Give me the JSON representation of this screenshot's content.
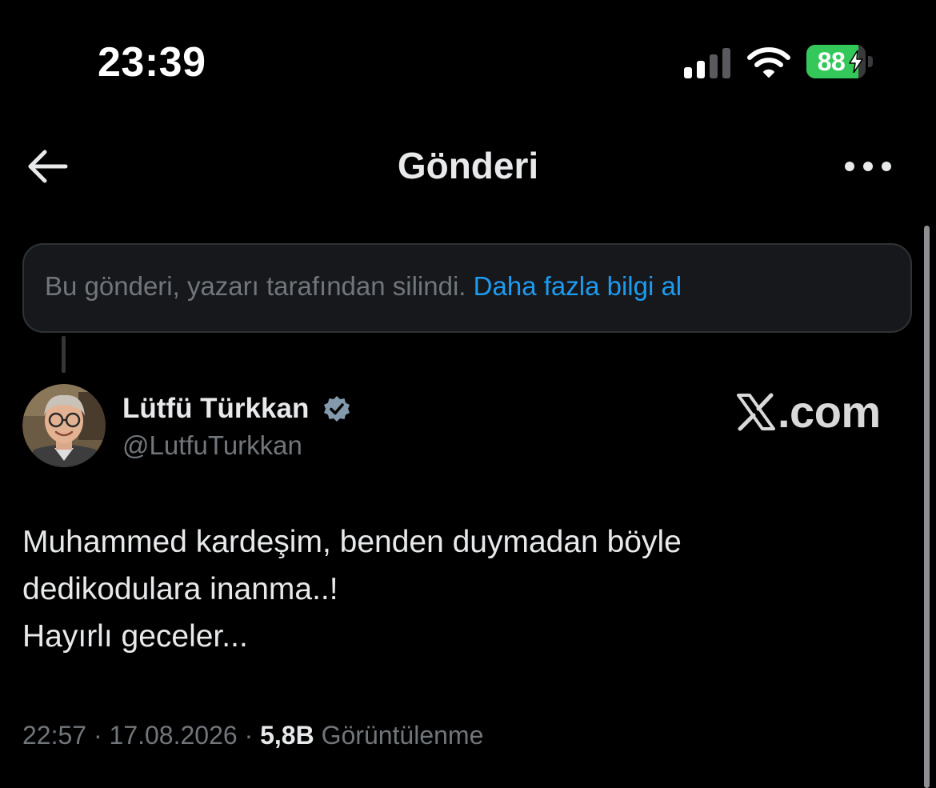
{
  "status_bar": {
    "time": "23:39",
    "battery_percent": 88,
    "battery_label": "88",
    "charging": true,
    "signal_bars_active": 2,
    "signal_bars_total": 4,
    "icons": [
      "signal-icon",
      "wifi-icon",
      "battery-icon",
      "charging-icon"
    ]
  },
  "header": {
    "title": "Gönderi",
    "back_icon": "arrow-left-icon",
    "more_icon": "ellipsis-icon"
  },
  "deleted_notice": {
    "text": "Bu gönderi, yazarı tarafından silindi.",
    "link": "Daha fazla bilgi al"
  },
  "post": {
    "author": {
      "display_name": "Lütfü Türkkan",
      "username": "@LutfuTurkkan",
      "verified": true
    },
    "watermark": "X.com",
    "watermark_suffix": ".com",
    "text_lines": [
      "Muhammed kardeşim, benden duymadan böyle",
      "dedikodulara inanma..!",
      "Hayırlı geceler..."
    ],
    "time": "22:57",
    "date": "17.08.2026",
    "separator": "·",
    "views_count": "5,8B",
    "views_label": "Görüntülenme"
  },
  "colors": {
    "background": "#000000",
    "primary_text": "#e7e9ea",
    "secondary_text": "#71767b",
    "link": "#1d9bf0",
    "battery_green": "#34c759",
    "notice_border": "#2f3336",
    "notice_background": "#16181c"
  }
}
